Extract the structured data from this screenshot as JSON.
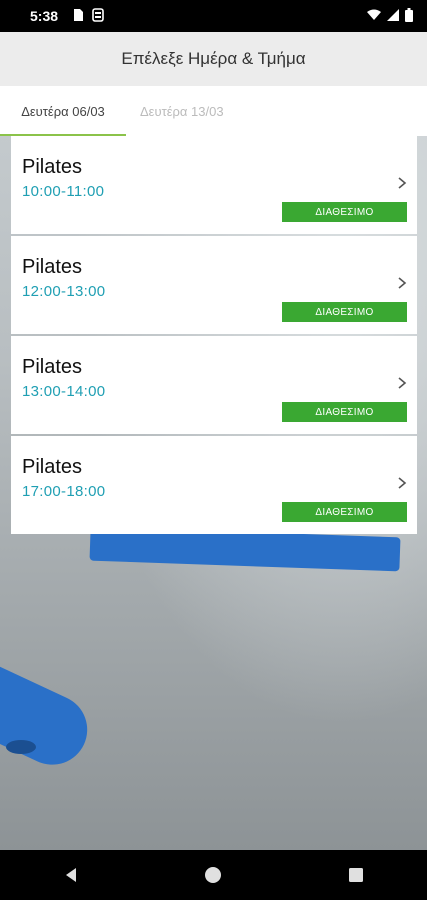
{
  "status_bar": {
    "time": "5:38",
    "icons": [
      "sim-card-icon",
      "signal-icon",
      "wifi-icon",
      "battery-icon"
    ]
  },
  "app_bar": {
    "title": "Επέλεξε Ημέρα & Τμήμα"
  },
  "tabs": [
    {
      "label": "Δευτέρα 06/03",
      "active": true
    },
    {
      "label": "Δευτέρα 13/03",
      "active": false
    }
  ],
  "slots": [
    {
      "title": "Pilates",
      "time": "10:00-11:00",
      "status": "ΔΙΑΘΕΣΙΜΟ"
    },
    {
      "title": "Pilates",
      "time": "12:00-13:00",
      "status": "ΔΙΑΘΕΣΙΜΟ"
    },
    {
      "title": "Pilates",
      "time": "13:00-14:00",
      "status": "ΔΙΑΘΕΣΙΜΟ"
    },
    {
      "title": "Pilates",
      "time": "17:00-18:00",
      "status": "ΔΙΑΘΕΣΙΜΟ"
    }
  ],
  "colors": {
    "accent_tab": "#8bc34a",
    "time_text": "#1f9fb3",
    "badge_bg": "#3aa832"
  },
  "nav_bar": {
    "buttons": [
      "back-icon",
      "home-icon",
      "recents-icon"
    ]
  }
}
